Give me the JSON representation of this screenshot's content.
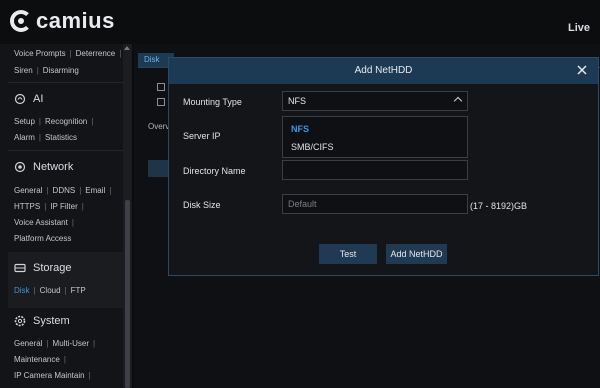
{
  "brand": {
    "logo_text": "camius"
  },
  "header": {
    "live_label": "Live"
  },
  "sidebar": {
    "line1": [
      "Voice Prompts",
      "Deterrence"
    ],
    "line2": [
      "Siren",
      "Disarming"
    ],
    "ai": {
      "title": "AI",
      "links": [
        [
          "Setup",
          "Recognition"
        ],
        [
          "Alarm",
          "Statistics"
        ]
      ]
    },
    "network": {
      "title": "Network",
      "links": [
        [
          "General",
          "DDNS",
          "Email"
        ],
        [
          "HTTPS",
          "IP Filter"
        ],
        [
          "Voice Assistant"
        ],
        [
          "Platform Access"
        ]
      ]
    },
    "storage": {
      "title": "Storage",
      "links": [
        "Disk",
        "Cloud",
        "FTP"
      ],
      "active": "Disk"
    },
    "system": {
      "title": "System",
      "links": [
        [
          "General",
          "Multi-User"
        ],
        [
          "Maintenance"
        ],
        [
          "IP Camera Maintain"
        ]
      ]
    }
  },
  "content": {
    "tab_label": "Disk",
    "partial_label": "Overv"
  },
  "dialog": {
    "title": "Add NetHDD",
    "mounting_type_label": "Mounting Type",
    "mounting_type_value": "NFS",
    "options": [
      "NFS",
      "SMB/CIFS"
    ],
    "selected_option": "NFS",
    "server_ip_label": "Server IP",
    "directory_name_label": "Directory Name",
    "disk_size_label": "Disk Size",
    "disk_size_placeholder": "Default",
    "disk_size_range": "(17 - 8192)GB",
    "test_button": "Test",
    "add_button": "Add NetHDD"
  },
  "colors": {
    "accent": "#3a96dd",
    "header_blue": "#1d3a55",
    "button_blue": "#1f3a52"
  }
}
